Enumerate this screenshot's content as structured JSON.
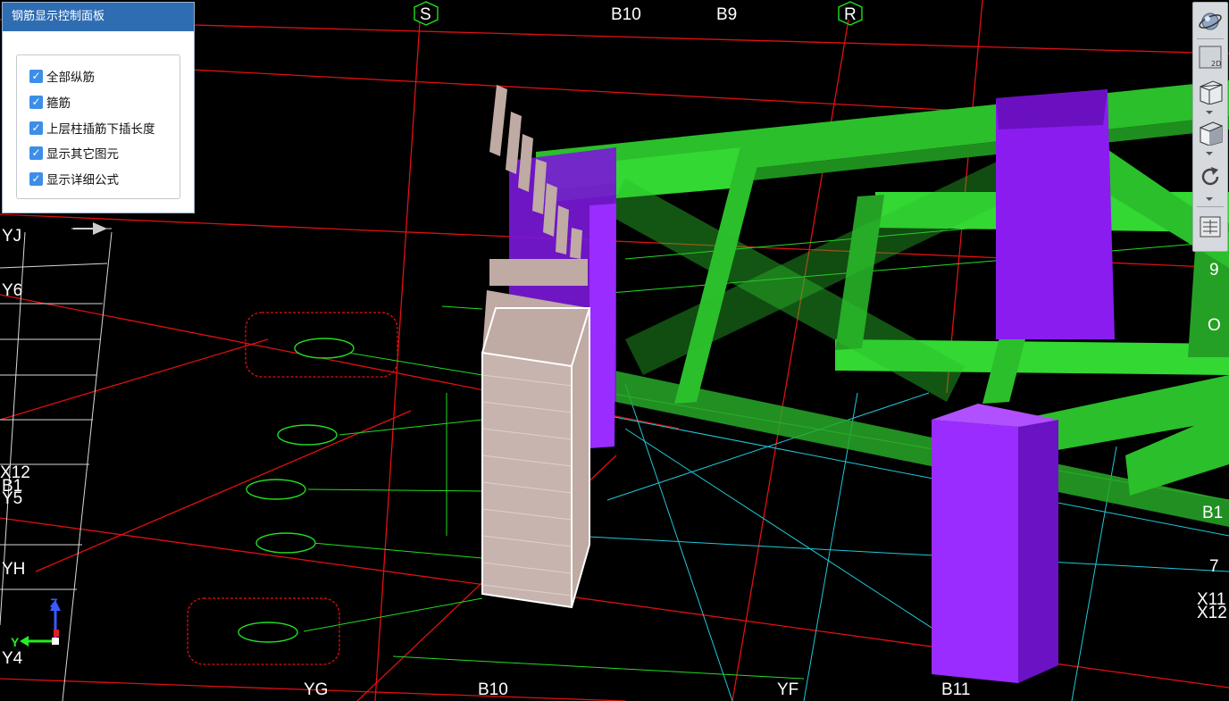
{
  "panel": {
    "title": "钢筋显示控制面板",
    "options": [
      {
        "label": "全部纵筋",
        "checked": true
      },
      {
        "label": "箍筋",
        "checked": true
      },
      {
        "label": "上层柱插筋下插长度",
        "checked": true
      },
      {
        "label": "显示其它图元",
        "checked": true
      },
      {
        "label": "显示详细公式",
        "checked": true
      }
    ]
  },
  "toolbar": {
    "items": [
      {
        "name": "dynamic-observe",
        "icon": "sphere-orbit-icon"
      },
      {
        "name": "2d-view",
        "icon": "2d-view-icon",
        "text": "2D"
      },
      {
        "name": "3d-view",
        "icon": "3d-box-icon"
      },
      {
        "name": "display-mode",
        "icon": "cube-icon"
      },
      {
        "name": "rotate",
        "icon": "rotate-icon"
      },
      {
        "name": "display-settings",
        "icon": "display-settings-icon"
      }
    ]
  },
  "axes": {
    "top": [
      "S",
      "B10",
      "B9",
      "R"
    ],
    "left": [
      "YJ",
      "Y6",
      "X12",
      "B1",
      "Y5",
      "YH",
      "Y4"
    ],
    "bottom": [
      "YG",
      "B10",
      "YF",
      "B11"
    ],
    "right": [
      "9",
      "O",
      "B1",
      "7",
      "X11",
      "X12"
    ],
    "gizmo": {
      "z": "Z",
      "y": "Y"
    }
  },
  "colors": {
    "background": "#000000",
    "grid_red": "#e01010",
    "grid_green": "#22dd22",
    "grid_cyan": "#20c8d8",
    "grid_white": "#e8e8e8",
    "beam_green": "#2bbf2b",
    "column_purple": "#8a1cf0",
    "rebar_pink": "#bfaaa4",
    "panel_title": "#2f6db3",
    "checkbox": "#3c8ee8"
  }
}
